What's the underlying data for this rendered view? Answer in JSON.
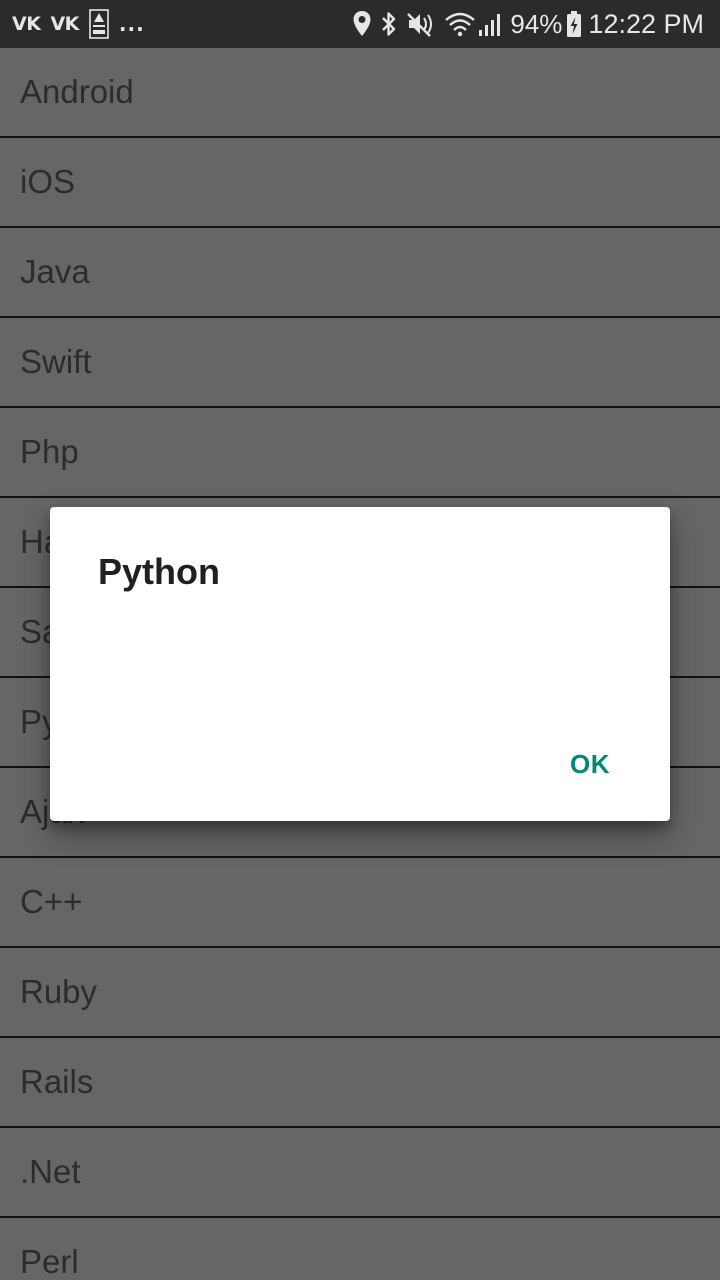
{
  "status_bar": {
    "left_apps": [
      "VK",
      "VK"
    ],
    "left_extra_icon": "asf-live-icon",
    "more_indicator": "...",
    "icons": [
      "location-icon",
      "bluetooth-icon",
      "mute-icon",
      "wifi-icon",
      "signal-icon"
    ],
    "battery_percent": "94%",
    "battery_icon": "battery-charging-icon",
    "time": "12:22 PM"
  },
  "list": {
    "items": [
      "Android",
      "iOS",
      "Java",
      "Swift",
      "Php",
      "Hadoop",
      "Sap",
      "Python",
      "Ajax",
      "C++",
      "Ruby",
      "Rails",
      ".Net",
      "Perl"
    ]
  },
  "dialog": {
    "title": "Python",
    "ok_label": "OK"
  },
  "colors": {
    "status_bar_bg": "#2b2b2b",
    "list_bg": "#666666",
    "divider": "#111111",
    "dialog_bg": "#ffffff",
    "accent": "#00897b"
  }
}
